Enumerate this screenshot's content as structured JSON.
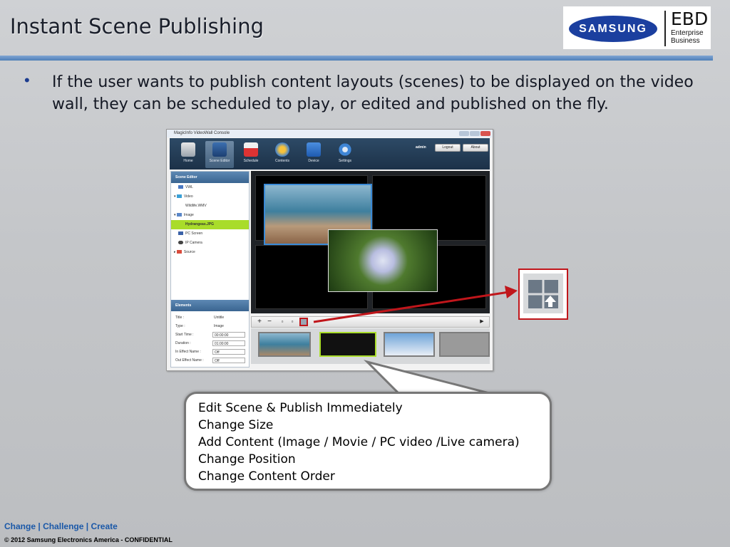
{
  "slide": {
    "title": "Instant Scene Publishing",
    "bullet": "If the user wants to publish content layouts (scenes) to be displayed on the video wall, they can be scheduled to play, or edited and published on the fly.",
    "callout_lines": [
      "Edit Scene & Publish Immediately",
      "Change Size",
      "Add Content (Image / Movie / PC video /Live camera)",
      "Change Position",
      "Change Content Order"
    ],
    "footer": {
      "change": "Change",
      "challenge": "Challenge",
      "create": "Create",
      "separator": "|"
    },
    "copyright": "© 2012 Samsung Electronics America - CONFIDENTIAL",
    "accent_color": "#5b8bc5",
    "highlight_color": "#c0161b"
  },
  "logo": {
    "brand": "SAMSUNG",
    "unit": "EBD",
    "unit_sub_1": "Enterprise",
    "unit_sub_2": "Business"
  },
  "app": {
    "window_title": "MagicInfo VideoWall Console",
    "nav": [
      {
        "label": "Home",
        "icon": "home-icon",
        "active": false
      },
      {
        "label": "Scene Editor",
        "icon": "scene-editor-icon",
        "active": true
      },
      {
        "label": "Schedule",
        "icon": "calendar-icon",
        "active": false
      },
      {
        "label": "Contents",
        "icon": "contents-icon",
        "active": false
      },
      {
        "label": "Device",
        "icon": "device-icon",
        "active": false
      },
      {
        "label": "Settings",
        "icon": "gear-icon",
        "active": false
      }
    ],
    "user": "admin",
    "logout": "Logout",
    "about": "About",
    "scene_editor_header": "Scene Editor",
    "tree": [
      {
        "label": "VWL",
        "level": 1,
        "selected": false
      },
      {
        "label": "Video",
        "level": 1,
        "selected": false
      },
      {
        "label": "Wildlife.WMV",
        "level": 2,
        "selected": false
      },
      {
        "label": "Image",
        "level": 1,
        "selected": false
      },
      {
        "label": "Hydrangeas.JPG",
        "level": 2,
        "selected": true
      },
      {
        "label": "PC Screen",
        "level": 1,
        "selected": false
      },
      {
        "label": "IP Camera",
        "level": 1,
        "selected": false
      },
      {
        "label": "Source",
        "level": 1,
        "selected": false
      }
    ],
    "elements_header": "Elements",
    "elements": [
      {
        "label": "Title :",
        "value": "Untitle",
        "box": false
      },
      {
        "label": "Type :",
        "value": "Image",
        "box": false
      },
      {
        "label": "Start Time :",
        "value": "00:00:00",
        "box": true
      },
      {
        "label": "Duration :",
        "value": "01:00:00",
        "box": true
      },
      {
        "label": "In Effect Name :",
        "value": "Off",
        "box": true
      },
      {
        "label": "Out Effect Name :",
        "value": "Off",
        "box": true
      }
    ]
  }
}
